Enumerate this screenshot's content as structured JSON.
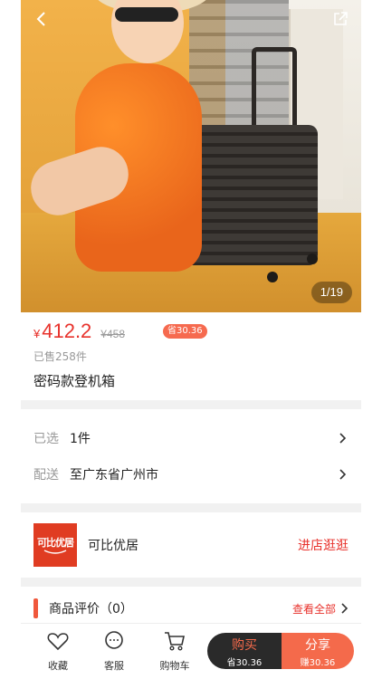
{
  "gallery": {
    "counter": "1/19"
  },
  "product": {
    "currency": "¥",
    "price": "412.2",
    "original_price": "¥458",
    "save_badge": "省30.36",
    "sold": "已售258件",
    "title": "密码款登机箱"
  },
  "options": {
    "selected_label": "已选",
    "selected_value": "1件",
    "shipping_label": "配送",
    "shipping_value": "至广东省广州市"
  },
  "store": {
    "logo_text": "可比优居",
    "name": "可比优居",
    "enter_label": "进店逛逛"
  },
  "reviews": {
    "title": "商品评价（0）",
    "view_all": "查看全部"
  },
  "bottom_bar": {
    "favorite": "收藏",
    "service": "客服",
    "cart": "购物车",
    "buy": "购买",
    "buy_sub": "省30.36",
    "share": "分享",
    "share_sub": "赚30.36"
  },
  "colors": {
    "accent": "#e8322c",
    "share_bg": "#f46a4b",
    "buy_bg": "#2a2a2a"
  }
}
